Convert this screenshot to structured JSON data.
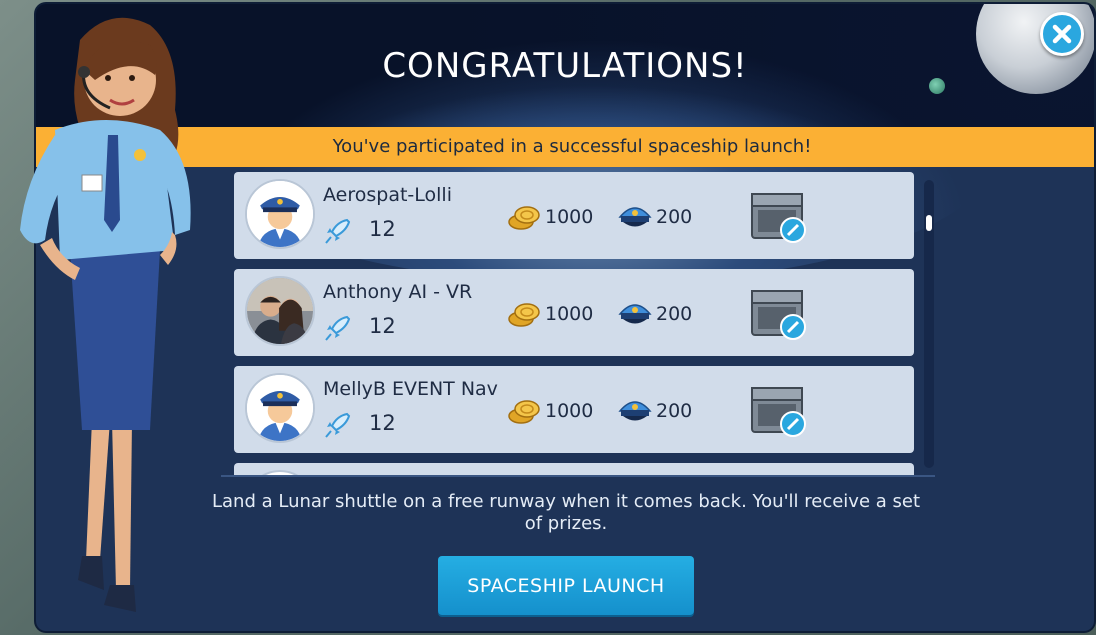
{
  "dialog": {
    "title": "CONGRATULATIONS!",
    "banner": "You've participated in a successful spaceship launch!",
    "close_icon": "close-icon",
    "info_text": "Land a Lunar shuttle on a free runway when it comes back. You'll receive a set of prizes.",
    "launch_button": "SPACESHIP LAUNCH"
  },
  "participants": [
    {
      "name": "Aerospat-Lolli",
      "launches": "12",
      "coins": "1000",
      "caps": "200",
      "avatar": "pilot-avatar"
    },
    {
      "name": "Anthony AI - VR",
      "launches": "12",
      "coins": "1000",
      "caps": "200",
      "avatar": "photo-avatar"
    },
    {
      "name": "MellyB EVENT Nav",
      "launches": "12",
      "coins": "1000",
      "caps": "200",
      "avatar": "pilot-avatar"
    }
  ],
  "colors": {
    "banner": "#fbb034",
    "dialog": "#1e3357",
    "row": "#d1dcea",
    "button": "#1ea3dc",
    "close": "#2aa7df"
  }
}
